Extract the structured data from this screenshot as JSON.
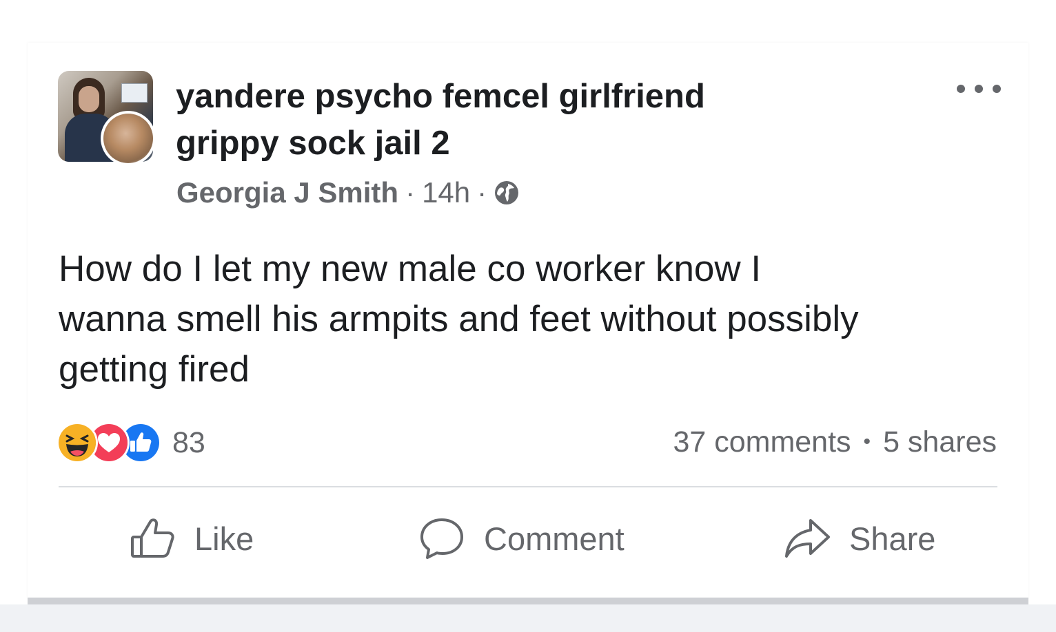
{
  "post": {
    "group_name_line1": "yandere psycho femcel girlfriend",
    "group_name_line2": "grippy sock jail 2",
    "author": "Georgia J Smith",
    "separator": "·",
    "time": "14h",
    "privacy_icon": "globe-icon",
    "more_icon": "more-options-icon",
    "body_lines": [
      "How do I let my new male co worker know I",
      "wanna smell his armpits and feet without possibly",
      "getting fired"
    ]
  },
  "reactions": {
    "icons": [
      "haha-icon",
      "love-icon",
      "like-icon"
    ],
    "count": "83",
    "comments": "37 comments",
    "bullet": "•",
    "shares": "5 shares"
  },
  "actions": {
    "like": "Like",
    "comment": "Comment",
    "share": "Share"
  },
  "colors": {
    "text": "#1c1e21",
    "secondary": "#65676b",
    "like_blue": "#1877f2",
    "love_red": "#f33e58",
    "haha_yellow": "#f7b125"
  }
}
